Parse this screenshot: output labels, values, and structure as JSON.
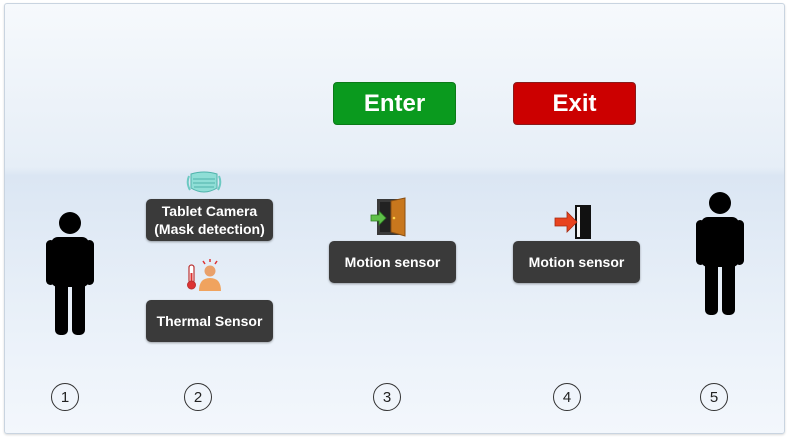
{
  "buttons": {
    "enter": {
      "label": "Enter",
      "color": "#0a9a1e"
    },
    "exit": {
      "label": "Exit",
      "color": "#cc0000"
    }
  },
  "labels": {
    "tablet_camera": "Tablet Camera\n(Mask detection)",
    "thermal_sensor": "Thermal Sensor",
    "motion_sensor_enter": "Motion sensor",
    "motion_sensor_exit": "Motion sensor"
  },
  "steps": [
    "1",
    "2",
    "3",
    "4",
    "5"
  ],
  "icons": {
    "person_left": "person-icon",
    "mask": "face-mask-icon",
    "thermometer": "thermometer-person-icon",
    "door_enter": "door-enter-icon",
    "door_exit": "door-exit-icon",
    "person_right": "person-icon"
  }
}
